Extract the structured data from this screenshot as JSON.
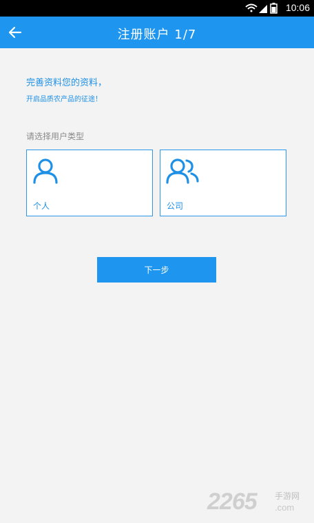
{
  "status_bar": {
    "time": "10:06",
    "icons": [
      "wifi-icon",
      "signal-icon",
      "battery-icon"
    ]
  },
  "app_bar": {
    "title": "注册账户 1/7",
    "back_icon": "arrow-left-icon",
    "background": "#1e96f0"
  },
  "intro": {
    "heading": "完善资料您的资料，",
    "subheading": "开启品质农产品的征途！"
  },
  "user_type": {
    "label": "请选择用户类型",
    "options": [
      {
        "label": "个人",
        "icon": "person-icon"
      },
      {
        "label": "公司",
        "icon": "group-icon"
      }
    ]
  },
  "next_button": {
    "label": "下一步"
  },
  "watermark": {
    "number": "2265",
    "cn": "手游网",
    "domain": ".com"
  },
  "colors": {
    "accent": "#1e96f0",
    "background": "#f3f3f3"
  }
}
